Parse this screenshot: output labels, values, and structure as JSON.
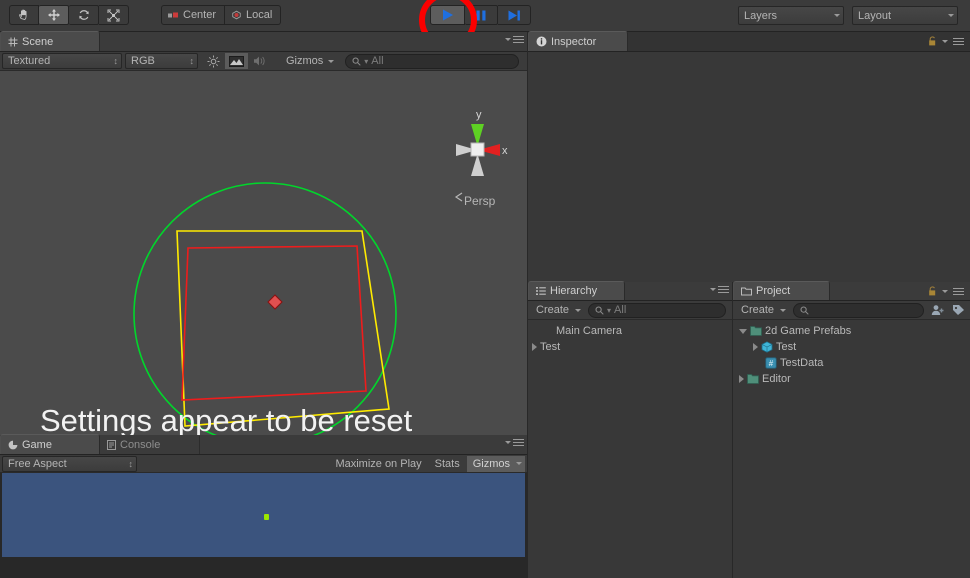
{
  "toolbar": {
    "tools": [
      {
        "name": "hand-tool",
        "icon": "hand-icon",
        "active": false
      },
      {
        "name": "move-tool",
        "icon": "move-icon",
        "active": true
      },
      {
        "name": "rotate-tool",
        "icon": "rotate-icon",
        "active": false
      },
      {
        "name": "scale-tool",
        "icon": "scale-icon",
        "active": false
      }
    ],
    "pivot_label": "Center",
    "rotation_label": "Local",
    "play_label": "Play",
    "pause_label": "Pause",
    "step_label": "Step",
    "layers_label": "Layers",
    "layout_label": "Layout"
  },
  "scene": {
    "tab_label": "Scene",
    "draw_mode": "Textured",
    "color_mode": "RGB",
    "gizmos_label": "Gizmos",
    "search_placeholder": "All",
    "gizmo_axis_y": "y",
    "gizmo_axis_x": "x",
    "projection_label": "Persp",
    "annotation_text": "Settings appear to be reset",
    "colors": {
      "circle": "#00d72b",
      "outer_quad": "#ffeb00",
      "inner_quad": "#ee1c1c",
      "handle": "#e03b3b",
      "background": "#4b4b4b"
    }
  },
  "inspector": {
    "tab_label": "Inspector"
  },
  "hierarchy": {
    "tab_label": "Hierarchy",
    "create_label": "Create",
    "search_placeholder": "All",
    "items": [
      {
        "label": "Main Camera",
        "indent": 1,
        "arrow": "none"
      },
      {
        "label": "Test",
        "indent": 0,
        "arrow": "closed"
      }
    ]
  },
  "project": {
    "tab_label": "Project",
    "create_label": "Create",
    "search_placeholder": "",
    "items": [
      {
        "label": "2d Game Prefabs",
        "indent": 0,
        "arrow": "open",
        "icon": "folder-icon"
      },
      {
        "label": "Test",
        "indent": 1,
        "arrow": "closed",
        "icon": "prefab-icon"
      },
      {
        "label": "TestData",
        "indent": 1,
        "arrow": "none",
        "icon": "script-icon"
      },
      {
        "label": "Editor",
        "indent": 0,
        "arrow": "closed",
        "icon": "folder-icon"
      }
    ]
  },
  "game": {
    "tab_label": "Game",
    "console_tab_label": "Console",
    "aspect_label": "Free Aspect",
    "maximize_label": "Maximize on Play",
    "stats_label": "Stats",
    "gizmos_label": "Gizmos",
    "view_background": "#3b547e",
    "dot_color": "#9ae600"
  }
}
